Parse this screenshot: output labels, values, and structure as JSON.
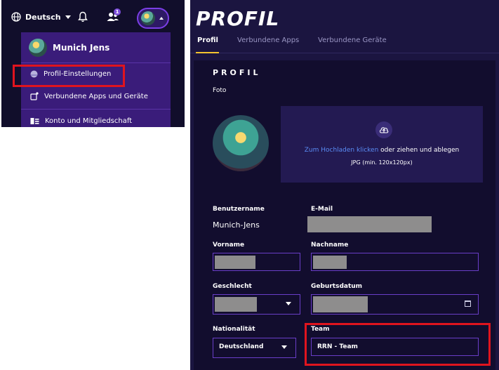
{
  "nav": {
    "language": "Deutsch",
    "friends_badge": "1"
  },
  "menu": {
    "user_name": "Munich Jens",
    "items": [
      {
        "label": "Profil-Einstellungen"
      },
      {
        "label": "Verbundene Apps und Geräte"
      },
      {
        "label": "Konto und Mitgliedschaft"
      }
    ]
  },
  "page": {
    "title": "PROFIL",
    "tabs": [
      {
        "label": "Profil"
      },
      {
        "label": "Verbundene Apps"
      },
      {
        "label": "Verbundene Geräte"
      }
    ]
  },
  "profile": {
    "section_title": "PROFIL",
    "foto_label": "Foto",
    "upload_link": "Zum Hochladen klicken",
    "upload_rest": " oder ziehen und ablegen",
    "upload_hint": "JPG (min. 120x120px)",
    "username_label": "Benutzername",
    "username_value": "Munich-Jens",
    "email_label": "E-Mail",
    "firstname_label": "Vorname",
    "lastname_label": "Nachname",
    "gender_label": "Geschlecht",
    "birthdate_label": "Geburtsdatum",
    "nationality_label": "Nationalität",
    "nationality_value": "Deutschland",
    "team_label": "Team",
    "team_value": "RRN - Team"
  },
  "colors": {
    "accent": "#7b3ee6",
    "highlight": "#e0141e",
    "tab_underline": "#f4c430",
    "link": "#5a8cf5"
  }
}
